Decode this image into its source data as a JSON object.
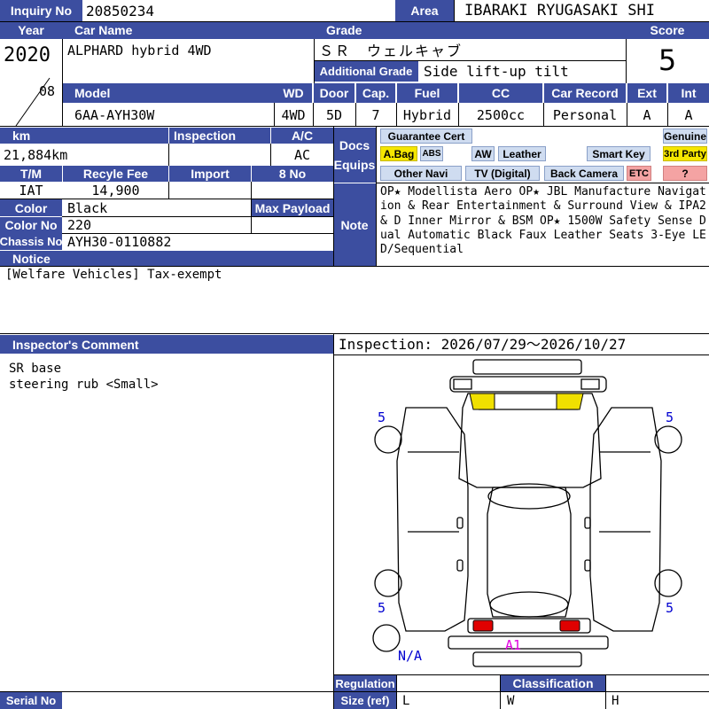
{
  "inquiry": {
    "label": "Inquiry No",
    "value": "20850234"
  },
  "area": {
    "label": "Area",
    "value": "IBARAKI RYUGASAKI SHI"
  },
  "year": {
    "label": "Year",
    "value": "2020",
    "month": "08"
  },
  "car_name": {
    "label": "Car Name",
    "value": "ALPHARD hybrid 4WD"
  },
  "grade": {
    "label": "Grade",
    "value": "ＳＲ　ウェルキャブ",
    "additional_label": "Additional Grade",
    "additional_value": "Side lift-up tilt"
  },
  "score": {
    "label": "Score",
    "value": "5"
  },
  "specs": {
    "model_label": "Model",
    "model": "6AA-AYH30W",
    "wd_label": "WD",
    "wd": "4WD",
    "door_label": "Door",
    "door": "5D",
    "cap_label": "Cap.",
    "cap": "7",
    "fuel_label": "Fuel",
    "fuel": "Hybrid",
    "cc_label": "CC",
    "cc": "2500cc",
    "record_label": "Car Record",
    "record": "Personal",
    "ext_label": "Ext",
    "ext": "A",
    "int_label": "Int",
    "int": "A"
  },
  "km": {
    "label": "km",
    "value": "21,884km"
  },
  "inspection": {
    "label": "Inspection",
    "value": ""
  },
  "ac": {
    "label": "A/C",
    "value": "AC"
  },
  "tm": {
    "label": "T/M",
    "value": "IAT"
  },
  "recycle": {
    "label": "Recyle Fee",
    "value": "14,900"
  },
  "import": {
    "label": "Import",
    "value": ""
  },
  "eight_no": {
    "label": "8 No",
    "value": ""
  },
  "color": {
    "label": "Color",
    "value": "Black"
  },
  "color_no": {
    "label": "Color No",
    "value": "220"
  },
  "max_payload": {
    "label": "Max Payload",
    "value": ""
  },
  "chassis": {
    "label": "Chassis No",
    "value": "AYH30-0110882"
  },
  "docs_equips": {
    "label_1": "Docs",
    "label_2": "Equips"
  },
  "equipment": {
    "guarantee": "Guarantee Cert",
    "genuine": "Genuine",
    "abag": "A.Bag",
    "abs": "ABS",
    "aw": "AW",
    "leather": "Leather",
    "smart_key": "Smart Key",
    "third_party": "3rd Party",
    "other_navi": "Other Navi",
    "tv": "TV (Digital)",
    "back_camera": "Back Camera",
    "etc": "ETC",
    "question": "?"
  },
  "colors": {
    "header": "#3c4ea0",
    "badge": "#cfdcf0",
    "highlight_yellow": "#f5e600",
    "highlight_pink": "#f4a3a3",
    "mark_blue": "#0000d0",
    "mark_magenta": "#e000e0",
    "part_yellow": "#f0e000",
    "part_red": "#e00000"
  },
  "note": {
    "label": "Note",
    "text": "OP★ Modellista Aero OP★ JBL Manufacture Navigation & Rear Entertainment & Surround View & IPA2 & D Inner Mirror & BSM OP★ 1500W Safety Sense Dual Automatic Black Faux Leather Seats 3-Eye LED/Sequential"
  },
  "notice": {
    "label": "Notice",
    "text": "[Welfare Vehicles] Tax-exempt"
  },
  "inspector": {
    "label": "Inspector's Comment",
    "lines": [
      "SR base",
      "steering rub <Small>"
    ]
  },
  "inspection_period": "Inspection: 2026/07/29～2026/10/27",
  "diagram": {
    "marks": [
      {
        "text": "5",
        "where": "front-left"
      },
      {
        "text": "5",
        "where": "front-right"
      },
      {
        "text": "5",
        "where": "rear-left"
      },
      {
        "text": "5",
        "where": "rear-right"
      },
      {
        "text": "N/A",
        "where": "spare-tire"
      },
      {
        "text": "A1",
        "where": "rear-bumper"
      }
    ]
  },
  "regulation": {
    "label": "Regulation"
  },
  "size": {
    "label": "Size (ref)",
    "l": "L",
    "w": "W",
    "h": "H"
  },
  "classification": {
    "label": "Classification"
  },
  "serial": {
    "label": "Serial No",
    "value": ""
  }
}
